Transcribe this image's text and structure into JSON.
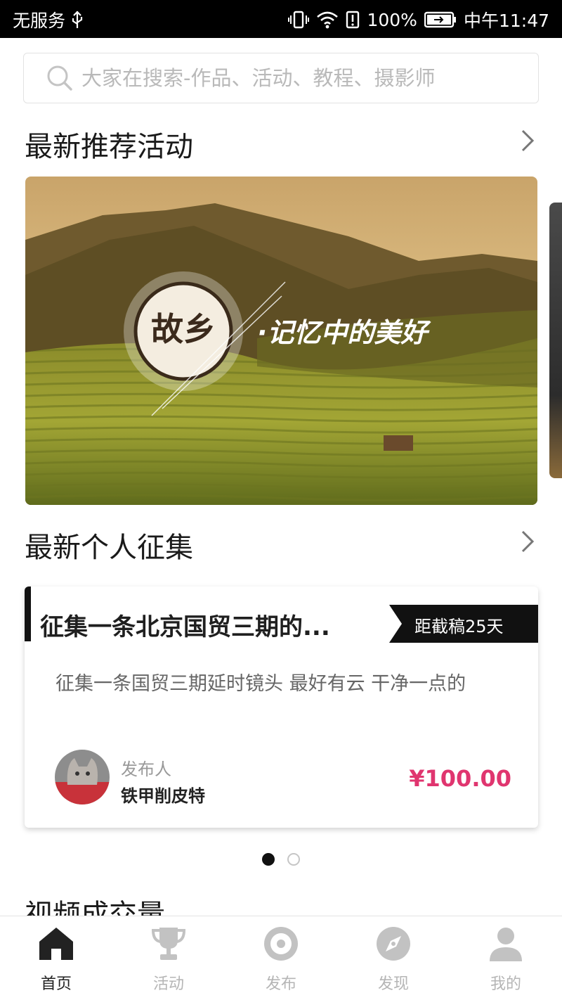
{
  "status_bar": {
    "carrier": "无服务",
    "battery": "100%",
    "time": "中午11:47"
  },
  "search": {
    "placeholder": "大家在搜索-作品、活动、教程、摄影师"
  },
  "sections": {
    "recommended": {
      "title": "最新推荐活动"
    },
    "personal": {
      "title": "最新个人征集"
    },
    "video": {
      "title": "视频成交量"
    }
  },
  "banner": {
    "badge_text": "故乡",
    "headline": "·记忆中的美好"
  },
  "collection_card": {
    "title": "征集一条北京国贸三期的...",
    "deadline": "距截稿25天",
    "description": "征集一条国贸三期延时镜头   最好有云    干净一点的",
    "publisher_label": "发布人",
    "publisher_name": "铁甲削皮特",
    "price": "¥100.00"
  },
  "pagination": {
    "count": 2,
    "active_index": 0
  },
  "tab_bar": {
    "items": [
      {
        "label": "首页",
        "icon": "home-icon",
        "active": true
      },
      {
        "label": "活动",
        "icon": "trophy-icon",
        "active": false
      },
      {
        "label": "发布",
        "icon": "publish-icon",
        "active": false
      },
      {
        "label": "发现",
        "icon": "compass-icon",
        "active": false
      },
      {
        "label": "我的",
        "icon": "user-icon",
        "active": false
      }
    ]
  },
  "colors": {
    "price": "#e0356f",
    "tab_active": "#222222",
    "tab_inactive": "#b5b5b5",
    "status_bar_bg": "#000000"
  }
}
